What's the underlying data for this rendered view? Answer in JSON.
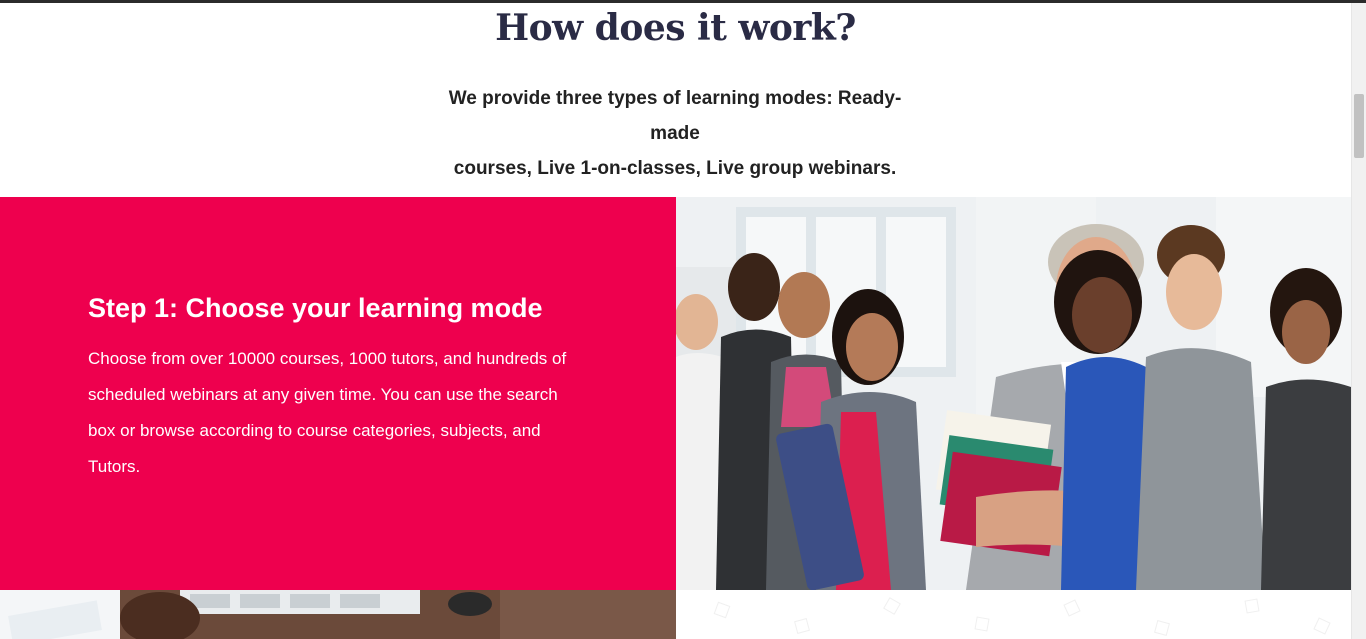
{
  "how_section": {
    "title": "How does it work?",
    "subtitle_line1": "We provide three types of learning modes: Ready-made",
    "subtitle_line2": "courses, Live 1-on-classes, Live group webinars."
  },
  "step1": {
    "title": "Step 1: Choose your learning mode",
    "body_line1": "Choose from over 10000 courses, 1000 tutors, and hundreds of",
    "body_line2": "scheduled webinars at any given time. You can use the search",
    "body_line3": "box or browse according to course categories, subjects, and",
    "body_line4": "Tutors."
  },
  "colors": {
    "accent": "#ee004e",
    "heading": "#2a2b45",
    "text_on_accent": "#ffffff"
  },
  "images": {
    "step1_photo": "group-of-smiling-students-with-teacher-holding-books",
    "step2_photo_partial": "hands-on-desk-with-calendar-planner"
  }
}
